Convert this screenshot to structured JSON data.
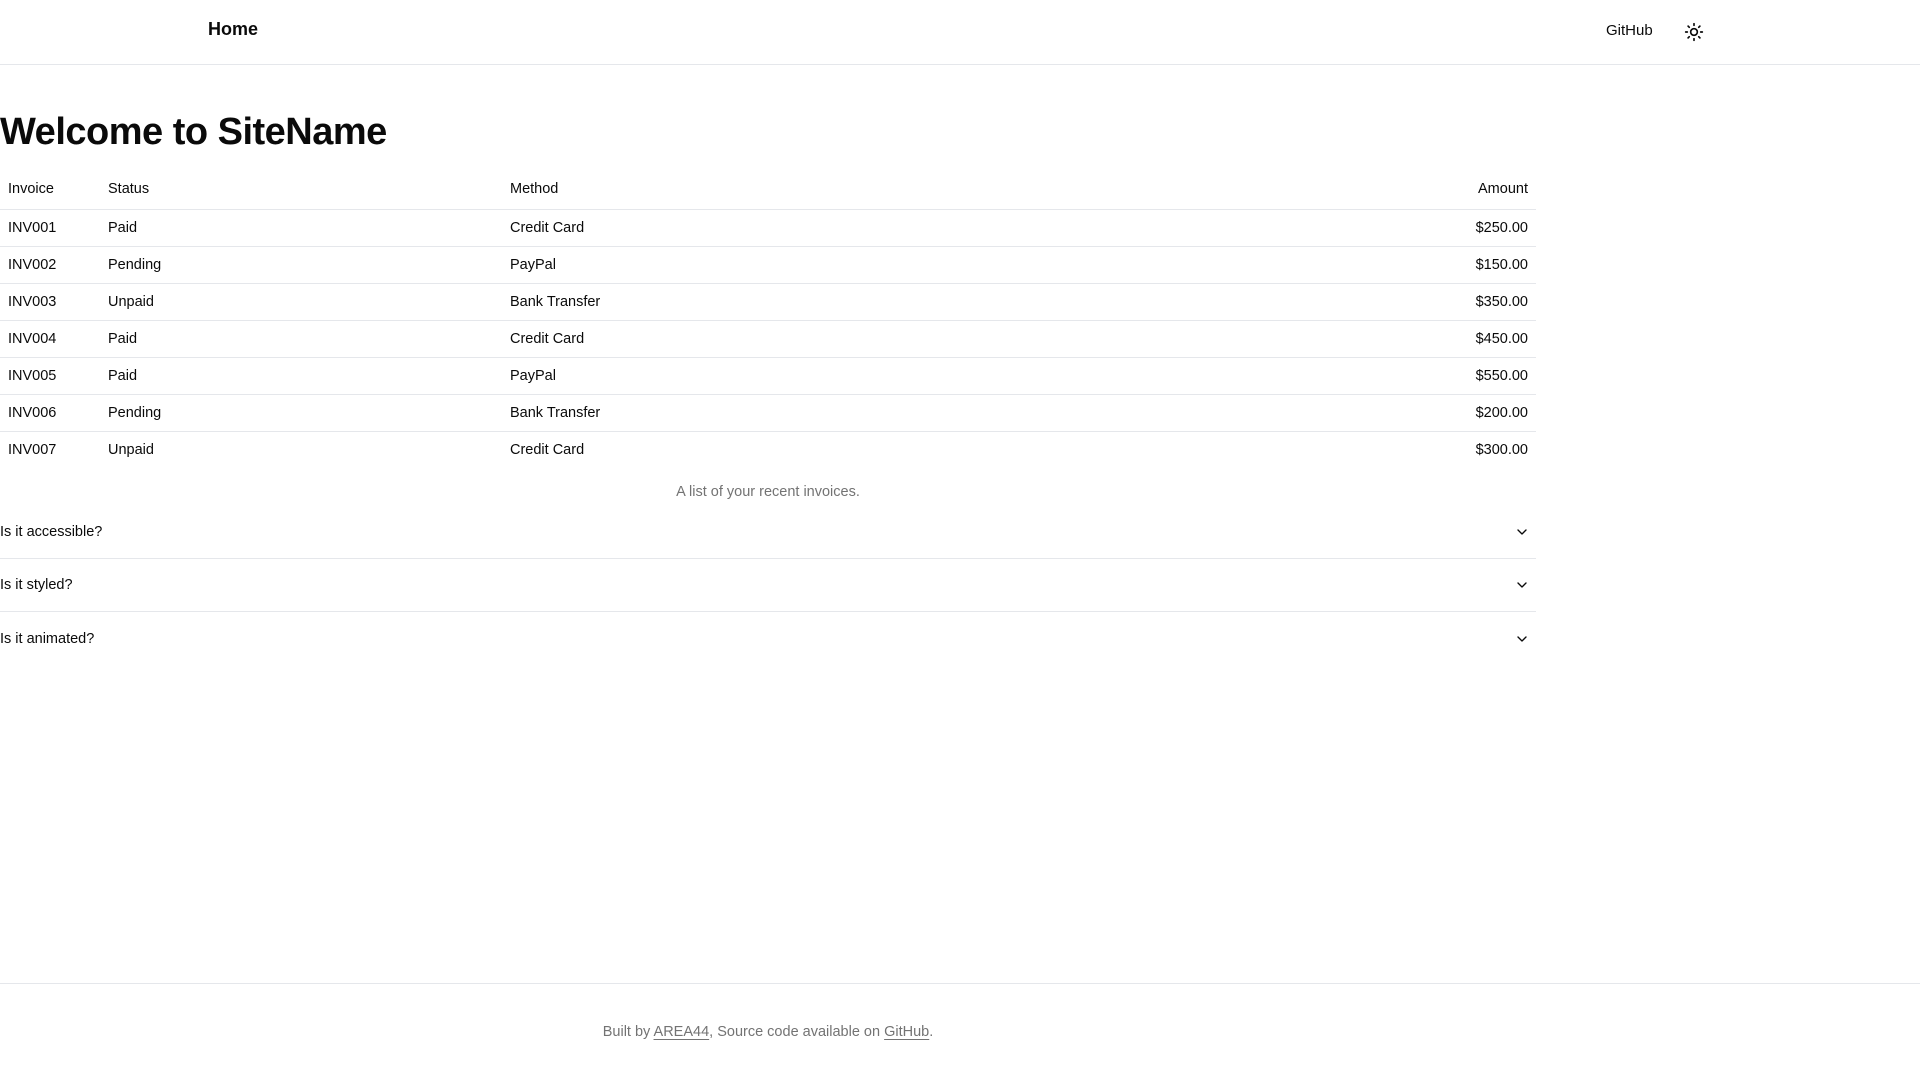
{
  "header": {
    "brand": "Home",
    "github_link": "GitHub",
    "theme_toggle_icon": "sun-icon"
  },
  "main": {
    "title": "Welcome to SiteName",
    "table": {
      "headers": [
        "Invoice",
        "Status",
        "Method",
        "Amount"
      ],
      "rows": [
        {
          "invoice": "INV001",
          "status": "Paid",
          "method": "Credit Card",
          "amount": "$250.00"
        },
        {
          "invoice": "INV002",
          "status": "Pending",
          "method": "PayPal",
          "amount": "$150.00"
        },
        {
          "invoice": "INV003",
          "status": "Unpaid",
          "method": "Bank Transfer",
          "amount": "$350.00"
        },
        {
          "invoice": "INV004",
          "status": "Paid",
          "method": "Credit Card",
          "amount": "$450.00"
        },
        {
          "invoice": "INV005",
          "status": "Paid",
          "method": "PayPal",
          "amount": "$550.00"
        },
        {
          "invoice": "INV006",
          "status": "Pending",
          "method": "Bank Transfer",
          "amount": "$200.00"
        },
        {
          "invoice": "INV007",
          "status": "Unpaid",
          "method": "Credit Card",
          "amount": "$300.00"
        }
      ],
      "caption": "A list of your recent invoices."
    },
    "accordion": [
      {
        "label": "Is it accessible?"
      },
      {
        "label": "Is it styled?"
      },
      {
        "label": "Is it animated?"
      }
    ]
  },
  "footer": {
    "prefix": "Built by",
    "author_link": "AREA44",
    "middle": ", Source code available on",
    "github_link": "GitHub",
    "suffix": "."
  },
  "colors": {
    "text": "#0a0a0a",
    "muted": "#737373",
    "border": "#e5e7eb",
    "background": "#ffffff"
  }
}
